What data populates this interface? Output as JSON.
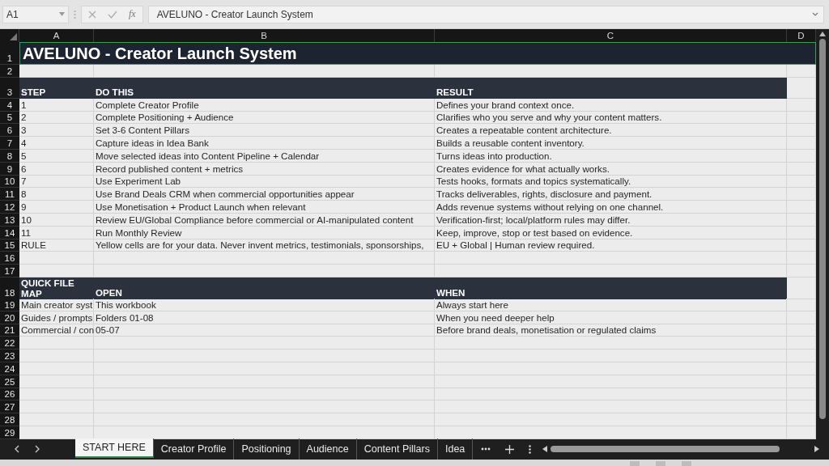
{
  "formula_bar": {
    "name_box": "A1",
    "function_label": "fx",
    "formula": "AVELUNO - Creator Launch System"
  },
  "columns": [
    "A",
    "B",
    "C",
    "D"
  ],
  "row_numbers": [
    "1",
    "2",
    "3",
    "4",
    "5",
    "6",
    "7",
    "8",
    "9",
    "10",
    "11",
    "12",
    "13",
    "14",
    "15",
    "16",
    "17",
    "18",
    "19",
    "20",
    "21",
    "22",
    "23",
    "24",
    "25",
    "26",
    "27",
    "28",
    "29"
  ],
  "title": "AVELUNO - Creator Launch System",
  "steps_table": {
    "headers": [
      "STEP",
      "DO THIS",
      "RESULT"
    ],
    "rows": [
      {
        "step": "1",
        "action": "Complete Creator Profile",
        "result": "Defines your brand context once."
      },
      {
        "step": "2",
        "action": "Complete Positioning + Audience",
        "result": "Clarifies who you serve and why your content matters."
      },
      {
        "step": "3",
        "action": "Set 3-6 Content Pillars",
        "result": "Creates a repeatable content architecture."
      },
      {
        "step": "4",
        "action": "Capture ideas in Idea Bank",
        "result": "Builds a reusable content inventory."
      },
      {
        "step": "5",
        "action": "Move selected ideas into Content Pipeline + Calendar",
        "result": "Turns ideas into production."
      },
      {
        "step": "6",
        "action": "Record published content + metrics",
        "result": "Creates evidence for what actually works."
      },
      {
        "step": "7",
        "action": "Use Experiment Lab",
        "result": "Tests hooks, formats and topics systematically."
      },
      {
        "step": "8",
        "action": "Use Brand Deals CRM when commercial opportunities appear",
        "result": "Tracks deliverables, rights, disclosure and payment."
      },
      {
        "step": "9",
        "action": "Use Monetisation + Product Launch when relevant",
        "result": "Adds revenue systems without relying on one channel."
      },
      {
        "step": "10",
        "action": "Review EU/Global Compliance before commercial or AI-manipulated content",
        "result": "Verification-first; local/platform rules may differ."
      },
      {
        "step": "11",
        "action": "Run Monthly Review",
        "result": "Keep, improve, stop or test based on evidence."
      },
      {
        "step": "RULE",
        "action": "Yellow cells are for your data. Never invent metrics, testimonials, sponsorships,",
        "result": "EU + Global | Human review required."
      }
    ]
  },
  "quick_file_map": {
    "headers": [
      "QUICK FILE MAP",
      "OPEN",
      "WHEN"
    ],
    "rows": [
      {
        "map": "Main creator syst",
        "open": "This workbook",
        "when": "Always start here"
      },
      {
        "map": "Guides / prompts",
        "open": "Folders 01-08",
        "when": "When you need deeper help"
      },
      {
        "map": "Commercial / con",
        "open": "05-07",
        "when": "Before brand deals, monetisation or regulated claims"
      }
    ]
  },
  "sheet_tabs": [
    {
      "label": "START HERE",
      "selected": true
    },
    {
      "label": "Creator Profile",
      "selected": false
    },
    {
      "label": "Positioning",
      "selected": false
    },
    {
      "label": "Audience",
      "selected": false
    },
    {
      "label": "Content Pillars",
      "selected": false
    },
    {
      "label": "Idea",
      "selected": false
    }
  ]
}
